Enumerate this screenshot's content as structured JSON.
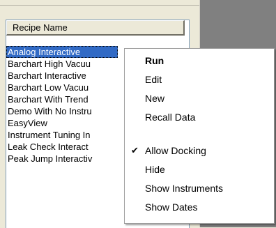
{
  "list": {
    "column_header": "Recipe Name",
    "items": [
      "Analog Interactive",
      "Barchart High Vacuu",
      "Barchart Interactive",
      "Barchart Low Vacuu",
      "Barchart With Trend",
      "Demo With No Instru",
      "EasyView",
      "Instrument Tuning In",
      "Leak Check Interact",
      "Peak Jump Interactiv"
    ],
    "selected_index": 0
  },
  "context_menu": {
    "items": [
      {
        "label": "Run",
        "bold": true
      },
      {
        "label": "Edit"
      },
      {
        "label": "New"
      },
      {
        "label": "Recall Data"
      },
      {
        "label": "Allow Docking",
        "checked": true
      },
      {
        "label": "Hide"
      },
      {
        "label": "Show Instruments"
      },
      {
        "label": "Show Dates"
      }
    ],
    "check_icon": "checkmark-icon"
  }
}
